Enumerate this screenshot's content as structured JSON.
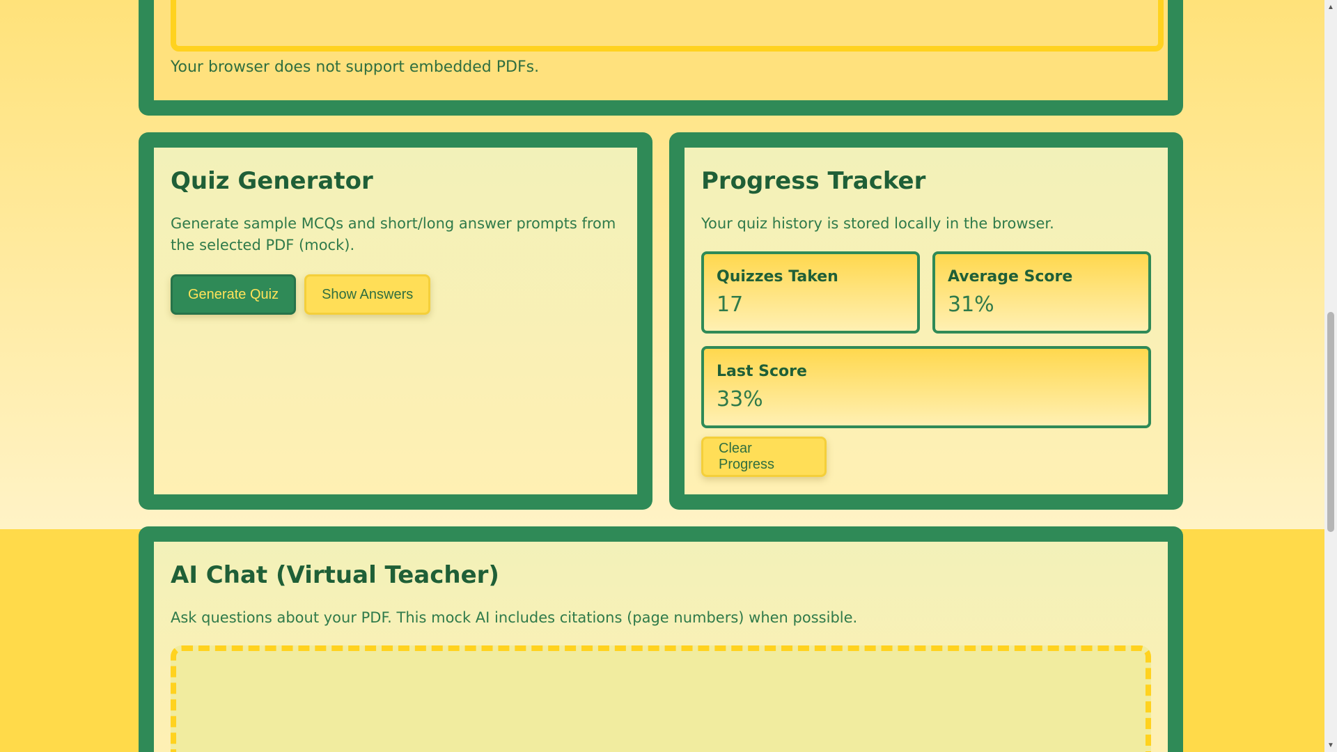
{
  "pdf_viewer": {
    "fallback_text": "Your browser does not support embedded PDFs."
  },
  "quiz_generator": {
    "title": "Quiz Generator",
    "description": "Generate sample MCQs and short/long answer prompts from the selected PDF (mock).",
    "generate_label": "Generate Quiz",
    "show_answers_label": "Show Answers"
  },
  "progress_tracker": {
    "title": "Progress Tracker",
    "description": "Your quiz history is stored locally in the browser.",
    "stats": [
      {
        "label": "Quizzes Taken",
        "value": "17"
      },
      {
        "label": "Average Score",
        "value": "31%"
      },
      {
        "label": "Last Score",
        "value": "33%"
      }
    ],
    "clear_label": "Clear Progress"
  },
  "ai_chat": {
    "title": "AI Chat (Virtual Teacher)",
    "description": "Ask questions about your PDF. This mock AI includes citations (page numbers) when possible."
  },
  "colors": {
    "panel_green": "#2f8a57",
    "accent_yellow": "#ffd21f",
    "text_green": "#1f5f37"
  }
}
